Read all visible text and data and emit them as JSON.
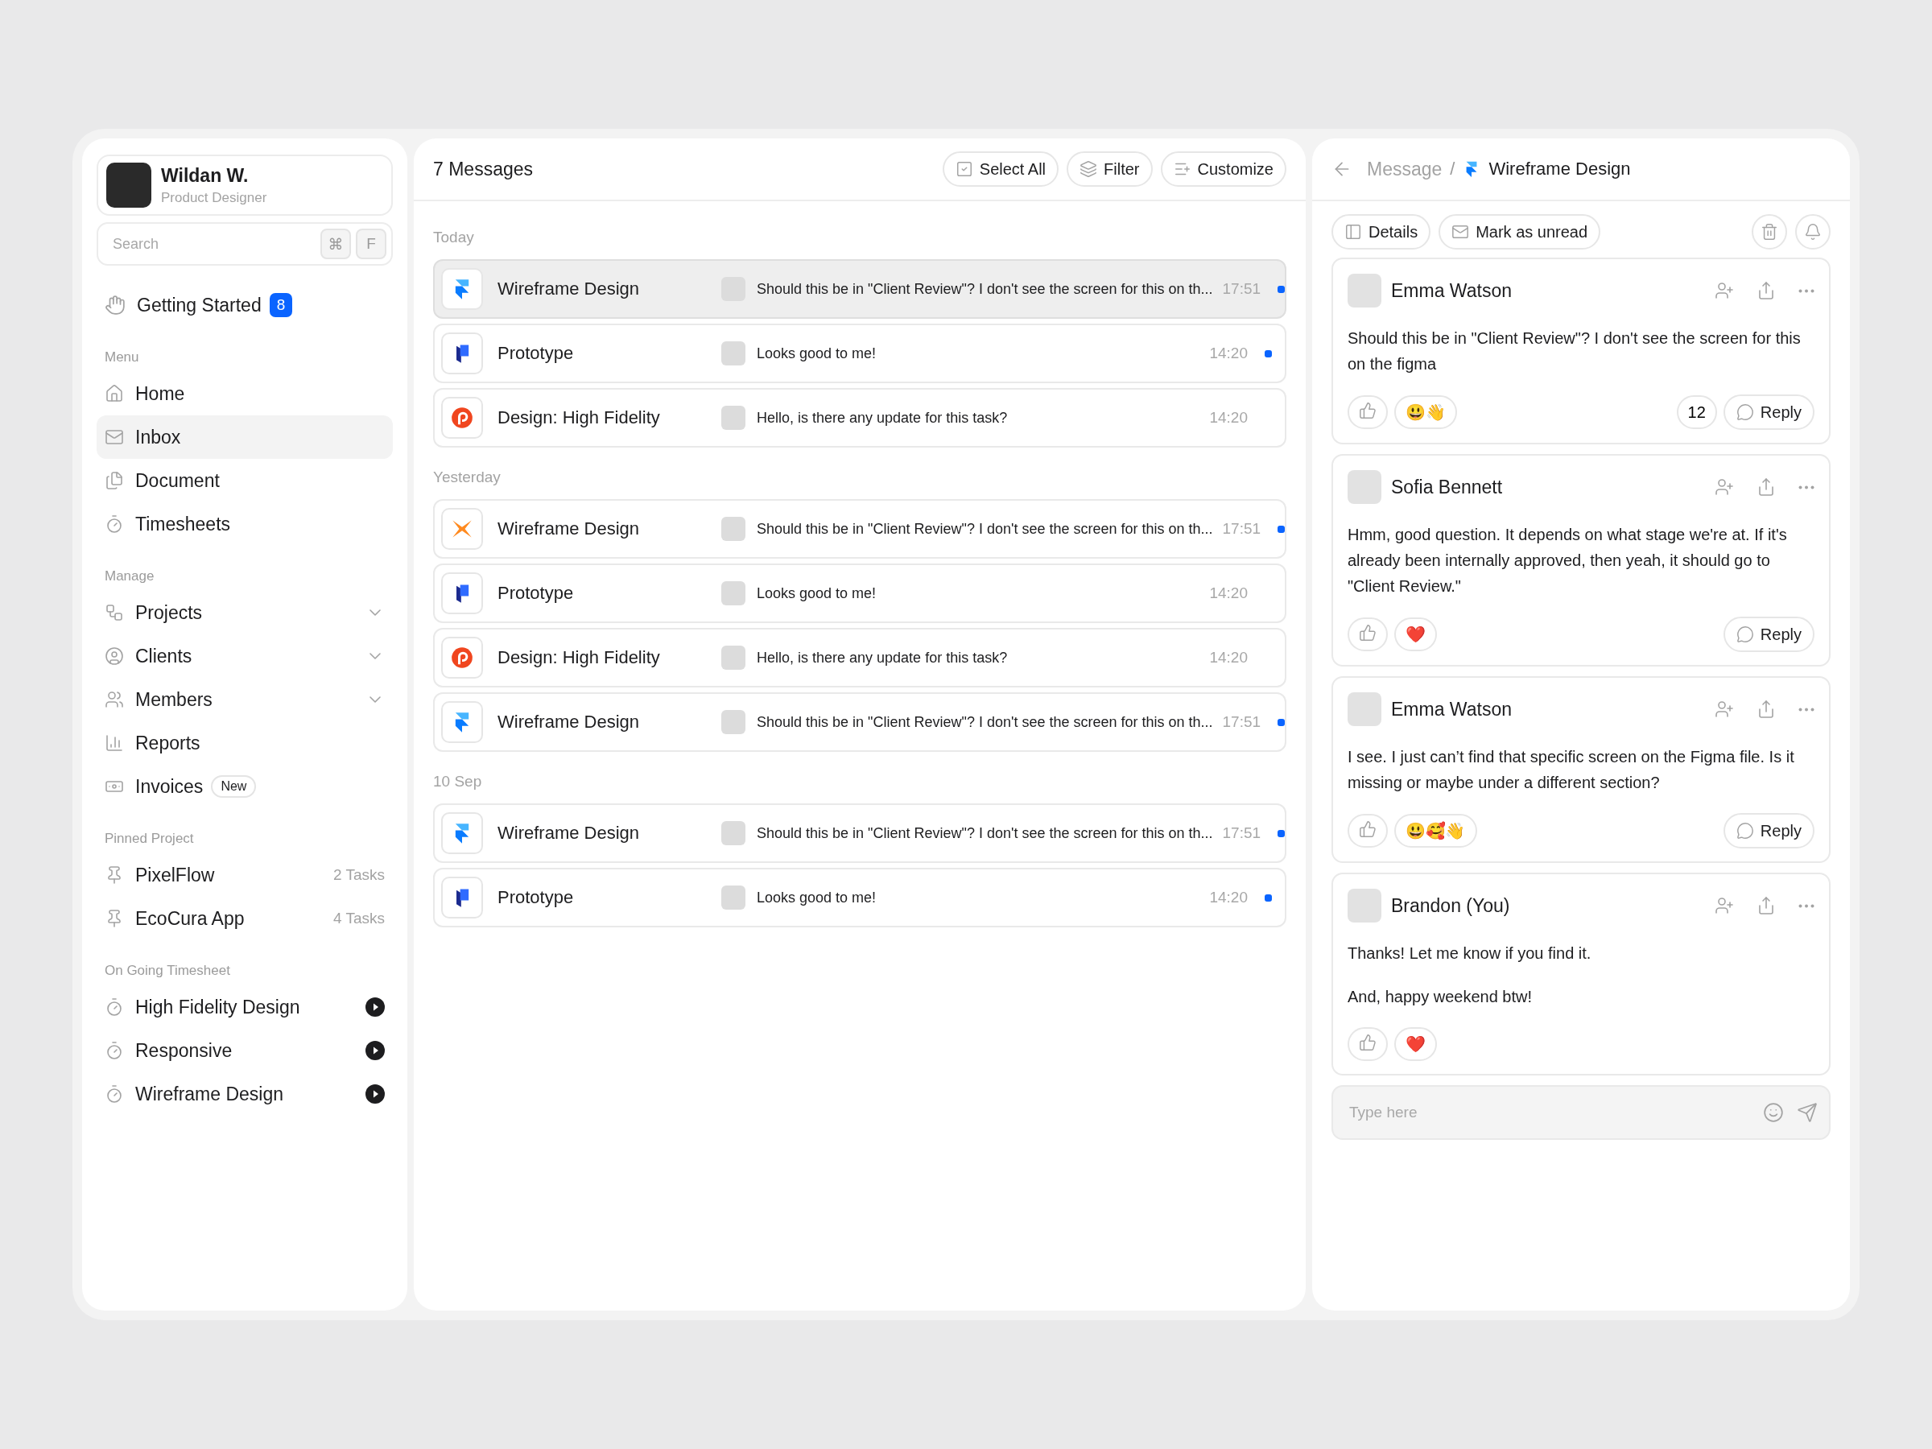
{
  "sidebar": {
    "profile": {
      "name": "Wildan W.",
      "role": "Product Designer"
    },
    "search": {
      "placeholder": "Search",
      "keys": [
        "⌘",
        "F"
      ]
    },
    "getting_started": {
      "label": "Getting Started",
      "badge": "8"
    },
    "sections": [
      {
        "title": "Menu",
        "items": [
          {
            "kind": "link",
            "label": "Home",
            "selected": false
          },
          {
            "kind": "link",
            "label": "Inbox",
            "selected": true
          },
          {
            "kind": "link",
            "label": "Document",
            "selected": false
          },
          {
            "kind": "link",
            "label": "Timesheets",
            "selected": false
          }
        ]
      },
      {
        "title": "Manage",
        "items": [
          {
            "kind": "group",
            "label": "Projects",
            "selected": false,
            "expanded": false
          },
          {
            "kind": "group",
            "label": "Clients",
            "selected": false,
            "expanded": false
          },
          {
            "kind": "group",
            "label": "Members",
            "selected": false,
            "expanded": false
          },
          {
            "kind": "link",
            "label": "Reports",
            "selected": false
          },
          {
            "kind": "link",
            "label": "Invoices",
            "selected": false,
            "tag": "New"
          }
        ]
      },
      {
        "title": "Pinned Project",
        "items": [
          {
            "kind": "pinned",
            "label": "PixelFlow",
            "selected": false,
            "meta": "2 Tasks"
          },
          {
            "kind": "pinned",
            "label": "EcoCura App",
            "selected": false,
            "meta": "4 Tasks"
          }
        ]
      },
      {
        "title": "On Going Timesheet",
        "items": [
          {
            "kind": "timer",
            "label": "High Fidelity Design",
            "selected": false
          },
          {
            "kind": "timer",
            "label": "Responsive",
            "selected": false
          },
          {
            "kind": "timer",
            "label": "Wireframe Design",
            "selected": false
          }
        ]
      }
    ]
  },
  "inbox": {
    "title": "7 Messages",
    "actions": [
      "Select All",
      "Filter",
      "Customize"
    ],
    "groups": [
      {
        "label": "Today",
        "rows": [
          {
            "kind": "arrow",
            "title": "Wireframe Design",
            "preview": "Should this be in \"Client Review\"? I don't see the screen for this on th...",
            "time": "17:51",
            "unread": true,
            "selected": true
          },
          {
            "kind": "block",
            "title": "Prototype",
            "preview": "Looks good to me!",
            "time": "14:20",
            "unread": true,
            "selected": false
          },
          {
            "kind": "p",
            "title": "Design: High Fidelity",
            "preview": "Hello, is there any update for this task?",
            "time": "14:20",
            "unread": false,
            "selected": false
          }
        ]
      },
      {
        "label": "Yesterday",
        "rows": [
          {
            "kind": "x",
            "title": "Wireframe Design",
            "preview": "Should this be in \"Client Review\"? I don't see the screen for this on th...",
            "time": "17:51",
            "unread": true,
            "selected": false
          },
          {
            "kind": "block",
            "title": "Prototype",
            "preview": "Looks good to me!",
            "time": "14:20",
            "unread": false,
            "selected": false
          },
          {
            "kind": "p",
            "title": "Design: High Fidelity",
            "preview": "Hello, is there any update for this task?",
            "time": "14:20",
            "unread": false,
            "selected": false
          },
          {
            "kind": "arrow",
            "title": "Wireframe Design",
            "preview": "Should this be in \"Client Review\"? I don't see the screen for this on th...",
            "time": "17:51",
            "unread": true,
            "selected": false
          }
        ]
      },
      {
        "label": "10 Sep",
        "rows": [
          {
            "kind": "arrow",
            "title": "Wireframe Design",
            "preview": "Should this be in \"Client Review\"? I don't see the screen for this on th...",
            "time": "17:51",
            "unread": true,
            "selected": false
          },
          {
            "kind": "block",
            "title": "Prototype",
            "preview": "Looks good to me!",
            "time": "14:20",
            "unread": true,
            "selected": false
          }
        ]
      }
    ]
  },
  "thread": {
    "breadcrumb": {
      "parent": "Message",
      "separator": "/",
      "current": "Wireframe Design"
    },
    "actions": [
      "Details",
      "Mark as unread"
    ],
    "messages": [
      {
        "author": "Emma Watson",
        "paragraphs": [
          "Should this be in \"Client Review\"? I don't see the screen for this on the figma"
        ],
        "reactions": [
          "😃👋"
        ],
        "count": "12",
        "reply": "Reply"
      },
      {
        "author": "Sofia Bennett",
        "paragraphs": [
          "Hmm, good question. It depends on what stage we're at. If it's already been internally approved, then yeah, it should go to \"Client Review.\""
        ],
        "reactions": [
          "❤️"
        ],
        "reply": "Reply"
      },
      {
        "author": "Emma Watson",
        "paragraphs": [
          "I see. I just can’t find that specific screen on the Figma file. Is it missing or maybe under a different section?"
        ],
        "reactions": [
          "😃🥰👋"
        ],
        "reply": "Reply"
      },
      {
        "author": "Brandon (You)",
        "paragraphs": [
          "Thanks! Let me know if you find it.",
          "And, happy weekend btw!"
        ],
        "reactions": [
          "❤️"
        ]
      }
    ],
    "composer": {
      "placeholder": "Type here"
    }
  }
}
